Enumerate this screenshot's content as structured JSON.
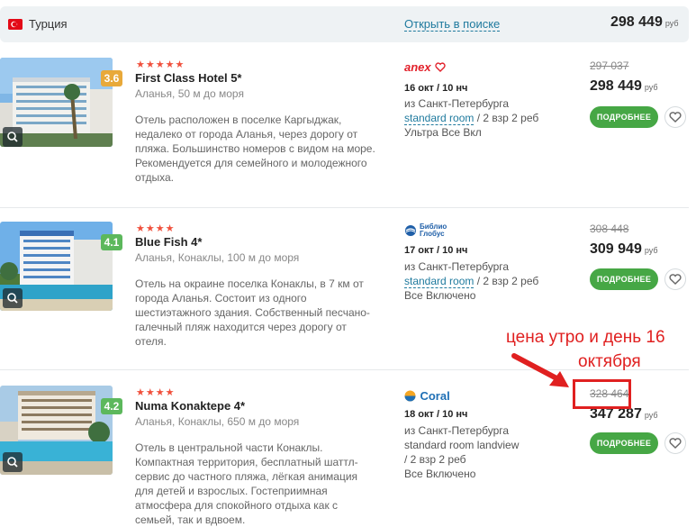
{
  "header": {
    "country": "Турция",
    "open_link": "Открыть в поиске",
    "price": "298 449",
    "currency": "руб"
  },
  "hotels": [
    {
      "stars": "★★★★★",
      "name": "First Class Hotel 5*",
      "rating": "3.6",
      "rating_color": "#e8a93a",
      "location": "Аланья, 50 м до моря",
      "description": "Отель расположен в поселке Каргыджак, недалеко от города Аланья, через дорогу от пляжа. Большинство номеров с видом на море. Рекомендуется для семейного и молодежного отдыха.",
      "operator": "anex",
      "operator_icon": "heart-logo-icon",
      "date": "16 окт / 10 нч",
      "from": "из Санкт-Петербурга",
      "room": "standard room",
      "guests": " / 2 взр 2 реб",
      "meal": "Ультра Все Вкл",
      "old_price": "297 037",
      "price": "298 449",
      "currency": "руб",
      "button": "ПОДРОБНЕЕ"
    },
    {
      "stars": "★★★★",
      "name": "Blue Fish 4*",
      "rating": "4.1",
      "rating_color": "#5cb85c",
      "location": "Аланья, Конаклы, 100 м до моря",
      "description": "Отель на окраине поселка Конаклы, в 7 км от города Аланья. Состоит из одного шестиэтажного здания. Собственный песчано-галечный пляж находится через дорогу от отеля.",
      "operator_line1": "Библио",
      "operator_line2": "Глобус",
      "date": "17 окт / 10 нч",
      "from": "из Санкт-Петербурга",
      "room": "standard room",
      "guests": " / 2 взр 2 реб",
      "meal": "Все Включено",
      "old_price": "308 448",
      "price": "309 949",
      "currency": "руб",
      "button": "ПОДРОБНЕЕ"
    },
    {
      "stars": "★★★★",
      "name": "Numa Konaktepe 4*",
      "rating": "4.2",
      "rating_color": "#5cb85c",
      "location": "Аланья, Конаклы, 650 м до моря",
      "description": "Отель в центральной части Конаклы. Компактная территория, бесплатный шаттл-сервис до частного пляжа, лёгкая анимация для детей и взрослых. Гостеприимная атмосфера для спокойного отдыха как с семьей, так и вдвоем.",
      "operator": "Coral",
      "date": "18 окт / 10 нч",
      "from": "из Санкт-Петербурга",
      "room": "standard room landview",
      "guests": " / 2 взр 2 реб",
      "meal": "Все Включено",
      "old_price": "328 464",
      "price": "347 287",
      "currency": "руб",
      "button": "ПОДРОБНЕЕ"
    }
  ],
  "annotation": {
    "line1": "цена утро и день 16",
    "line2": "октября",
    "color": "#e02020"
  }
}
